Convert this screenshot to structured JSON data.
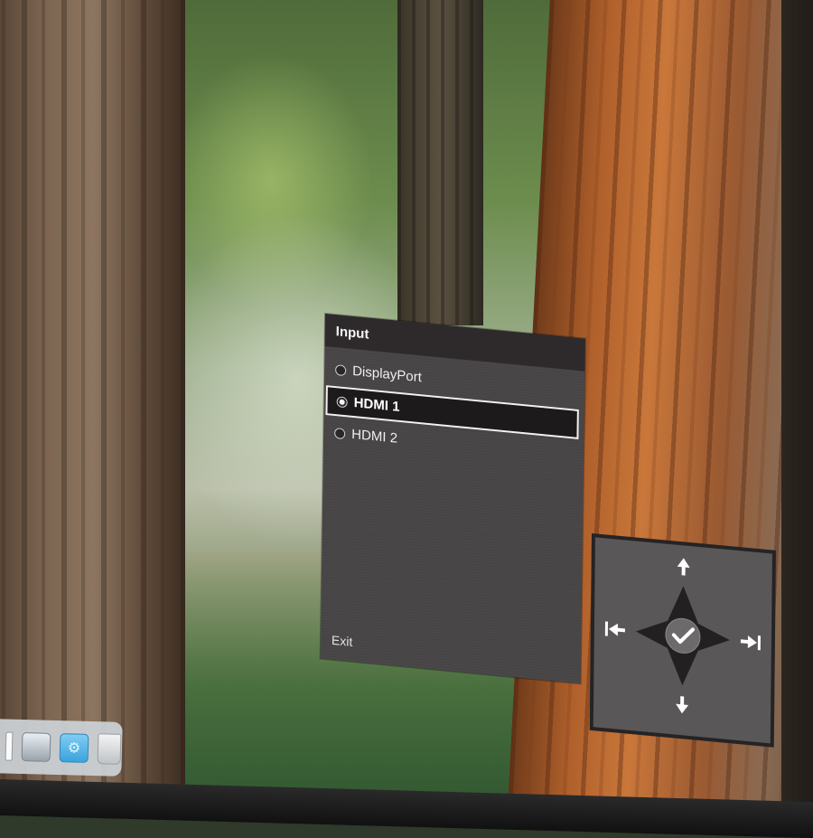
{
  "osd": {
    "menu_title": "Input",
    "options": [
      {
        "label": "DisplayPort",
        "selected": false
      },
      {
        "label": "HDMI 1",
        "selected": true
      },
      {
        "label": "HDMI 2",
        "selected": false
      }
    ],
    "exit_label": "Exit"
  },
  "nav_guide": {
    "icons": [
      "arrow-up-icon",
      "arrow-down-icon",
      "arrow-left-bar-icon",
      "arrow-right-bar-icon",
      "checkmark-icon"
    ]
  },
  "taskbar": {
    "icons": [
      "display-settings-icon",
      "folder-icon",
      "trash-icon"
    ]
  },
  "colors": {
    "menu_background": "#4a4749",
    "menu_header": "#2e2a2b",
    "selected_row": "#1d1a1b",
    "text": "#f1f1f1"
  }
}
